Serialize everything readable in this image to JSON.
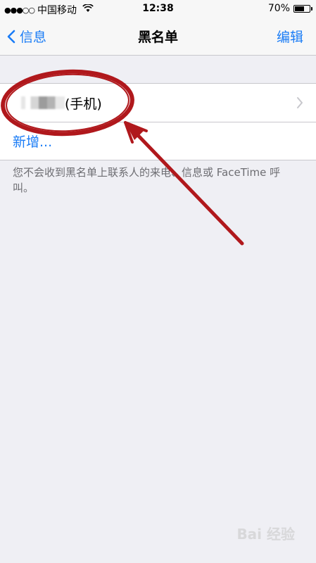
{
  "status_bar": {
    "signal_dots": "●●●○○",
    "carrier": "中国移动",
    "time": "12:38",
    "battery_percent_label": "70%",
    "battery_level": 0.7
  },
  "nav": {
    "back_label": "信息",
    "title": "黑名单",
    "edit_label": "编辑"
  },
  "blocked_list": {
    "items": [
      {
        "type_label": "(手机)"
      }
    ],
    "add_label": "新增..."
  },
  "footer_note": "您不会收到黑名单上联系人的来电、信息或 FaceTime 呼叫。",
  "colors": {
    "accent": "#1a7cf6",
    "annotation": "#b0181c",
    "background": "#efeff4"
  },
  "watermark": "Bai 经验"
}
